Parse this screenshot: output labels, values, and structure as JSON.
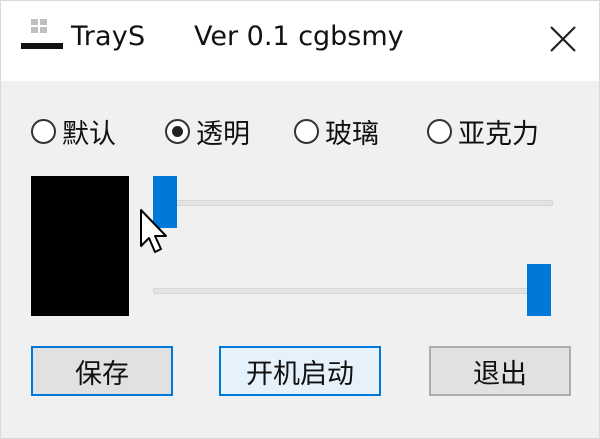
{
  "window": {
    "title": "TrayS",
    "version": "Ver 0.1 cgbsmy"
  },
  "icons": {
    "app": "app-tray-icon",
    "close": "close-icon",
    "cursor": "mouse-pointer-icon"
  },
  "radios": [
    {
      "label": "默认",
      "checked": false
    },
    {
      "label": "透明",
      "checked": true
    },
    {
      "label": "玻璃",
      "checked": false
    },
    {
      "label": "亚克力",
      "checked": false
    }
  ],
  "preview": {
    "color": "#000000"
  },
  "sliders": [
    {
      "name": "opacity",
      "value": 0.0
    },
    {
      "name": "color",
      "value": 1.0
    }
  ],
  "buttons": {
    "save": "保存",
    "autostart": "开机启动",
    "exit": "退出"
  },
  "colors": {
    "accent": "#0078d7",
    "body_bg": "#f0f0f0",
    "button_bg": "#e1e1e1",
    "hover_bg": "#e5f1fb"
  }
}
